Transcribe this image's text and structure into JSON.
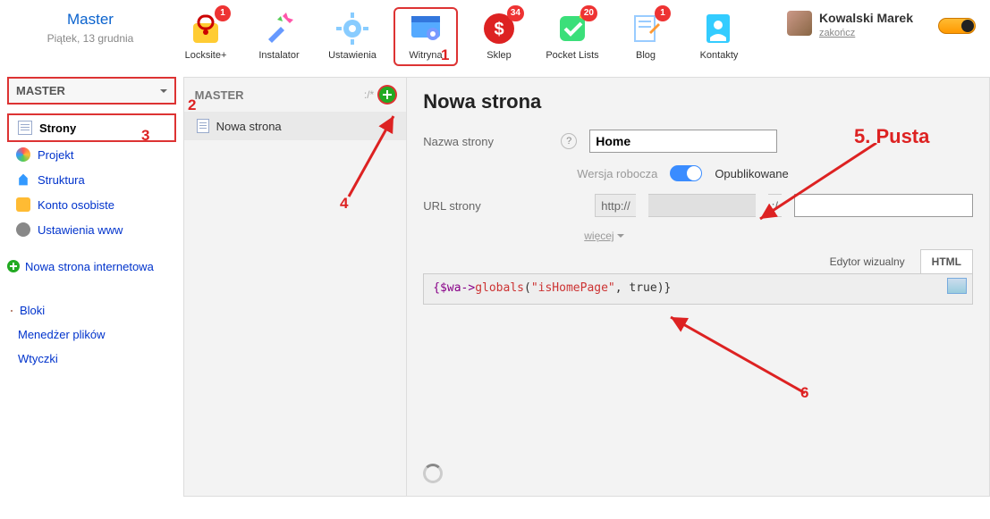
{
  "brand": {
    "title": "Master",
    "date": "Piątek, 13 grudnia"
  },
  "apps": [
    {
      "key": "locksite",
      "label": "Locksite+",
      "badge": "1"
    },
    {
      "key": "installer",
      "label": "Instalator",
      "badge": null
    },
    {
      "key": "settings",
      "label": "Ustawienia",
      "badge": null
    },
    {
      "key": "site",
      "label": "Witryna",
      "badge": null,
      "selected": true
    },
    {
      "key": "shop",
      "label": "Sklep",
      "badge": "34"
    },
    {
      "key": "pocket",
      "label": "Pocket Lists",
      "badge": "20"
    },
    {
      "key": "blog",
      "label": "Blog",
      "badge": "1"
    },
    {
      "key": "contacts",
      "label": "Kontakty",
      "badge": null
    }
  ],
  "user": {
    "name": "Kowalski Marek",
    "logout": "zakończ"
  },
  "site_selector": "MASTER",
  "nav": [
    {
      "key": "pages",
      "label": "Strony",
      "selected": true
    },
    {
      "key": "design",
      "label": "Projekt"
    },
    {
      "key": "structure",
      "label": "Struktura"
    },
    {
      "key": "account",
      "label": "Konto osobiste"
    },
    {
      "key": "wwwset",
      "label": "Ustawienia www"
    }
  ],
  "new_page_link": "Nowa strona internetowa",
  "secondary": [
    {
      "key": "blocks",
      "label": "Bloki"
    },
    {
      "key": "files",
      "label": "Menedżer plików"
    },
    {
      "key": "plugins",
      "label": "Wtyczki"
    }
  ],
  "mid": {
    "header": "MASTER",
    "path": ":/*",
    "page_item": "Nowa strona"
  },
  "form": {
    "title": "Nowa strona",
    "name_label": "Nazwa strony",
    "name_value": "Home",
    "draft_label": "Wersja robocza",
    "published_label": "Opublikowane",
    "url_label": "URL strony",
    "url_prefix": "http://",
    "url_slash": ":/",
    "more": "więcej"
  },
  "editor": {
    "tab_visual": "Edytor wizualny",
    "tab_html": "HTML",
    "code_prefix": "{$wa->",
    "code_func": "globals",
    "code_open": "(",
    "code_str": "\"isHomePage\"",
    "code_rest": ", true)}"
  },
  "annotations": {
    "n1": "1",
    "n2": "2",
    "n3": "3",
    "n4": "4",
    "n5": "5. Pusta",
    "n6": "6"
  }
}
